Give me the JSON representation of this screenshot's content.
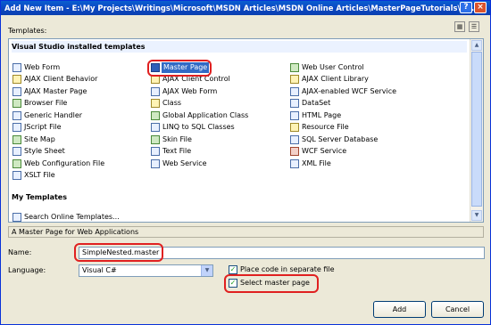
{
  "titlebar": {
    "title": "Add New Item - E:\\My Projects\\Writings\\Microsoft\\MSDN Articles\\MSDN Online Articles\\MasterPageTutorials\\C...",
    "help_glyph": "?",
    "close_glyph": "×"
  },
  "templates": {
    "label": "Templates:",
    "vs_header": "Visual Studio installed templates",
    "my_header": "My Templates",
    "col1": [
      "Web Form",
      "AJAX Client Behavior",
      "AJAX Master Page",
      "Browser File",
      "Generic Handler",
      "JScript File",
      "Site Map",
      "Style Sheet",
      "Web Configuration File",
      "XSLT File"
    ],
    "col2": [
      "Master Page",
      "AJAX Client Control",
      "AJAX Web Form",
      "Class",
      "Global Application Class",
      "LINQ to SQL Classes",
      "Skin File",
      "Text File",
      "Web Service"
    ],
    "col3": [
      "Web User Control",
      "AJAX Client Library",
      "AJAX-enabled WCF Service",
      "DataSet",
      "HTML Page",
      "Resource File",
      "SQL Server Database",
      "WCF Service",
      "XML File"
    ],
    "my_items": [
      "Search Online Templates..."
    ],
    "selected": "Master Page"
  },
  "description": "A Master Page for Web Applications",
  "form": {
    "name_label": "Name:",
    "name_value": "SimpleNested.master",
    "language_label": "Language:",
    "language_value": "Visual C#",
    "place_code_label": "Place code in separate file",
    "place_code_checked": true,
    "select_master_label": "Select master page",
    "select_master_checked": true
  },
  "buttons": {
    "add": "Add",
    "cancel": "Cancel"
  },
  "colors": {
    "highlight": "#e02020",
    "selection": "#316ac5",
    "titlebar": "#0a4fc4"
  }
}
